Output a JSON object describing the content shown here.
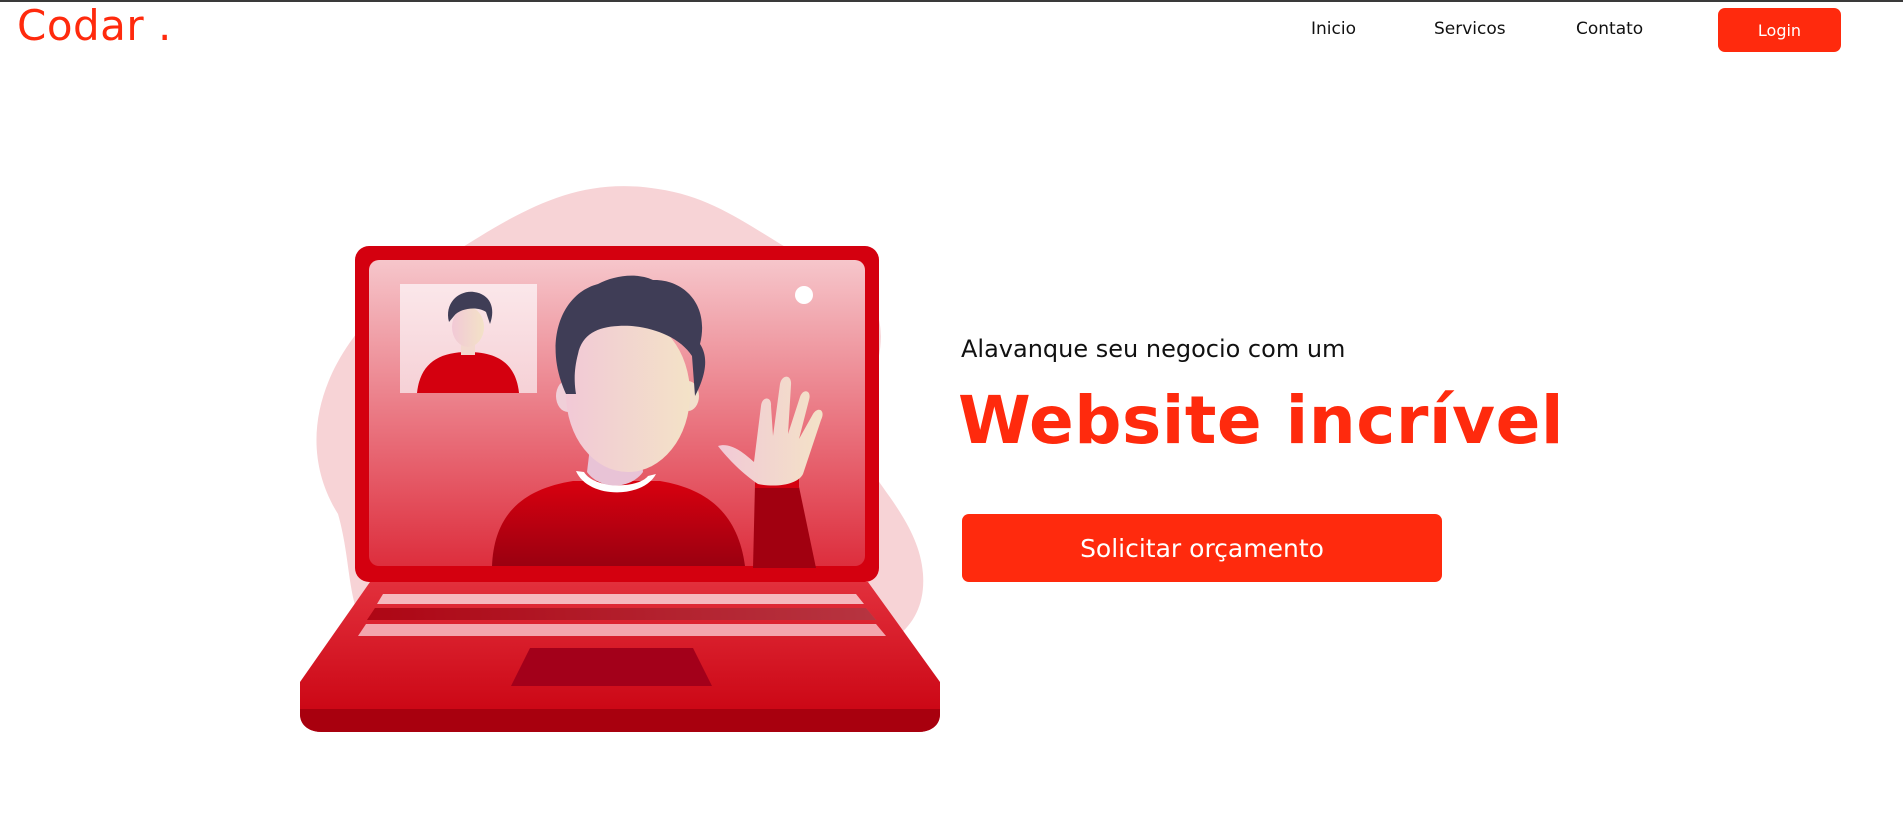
{
  "brand": {
    "logo_text": "Codar ."
  },
  "nav": {
    "links": [
      {
        "label": "Inicio"
      },
      {
        "label": "Servicos"
      },
      {
        "label": "Contato"
      }
    ],
    "login_label": "Login"
  },
  "hero": {
    "subtitle": "Alavanque seu negocio com um",
    "headline": "Website incrível",
    "cta_label": "Solicitar orçamento",
    "illustration": "laptop-video-call-illustration"
  },
  "colors": {
    "accent": "#ff2a0d",
    "laptop_red": "#d4000f",
    "blob_pink": "#f7d3d6",
    "hair_dark": "#3f3d56"
  }
}
